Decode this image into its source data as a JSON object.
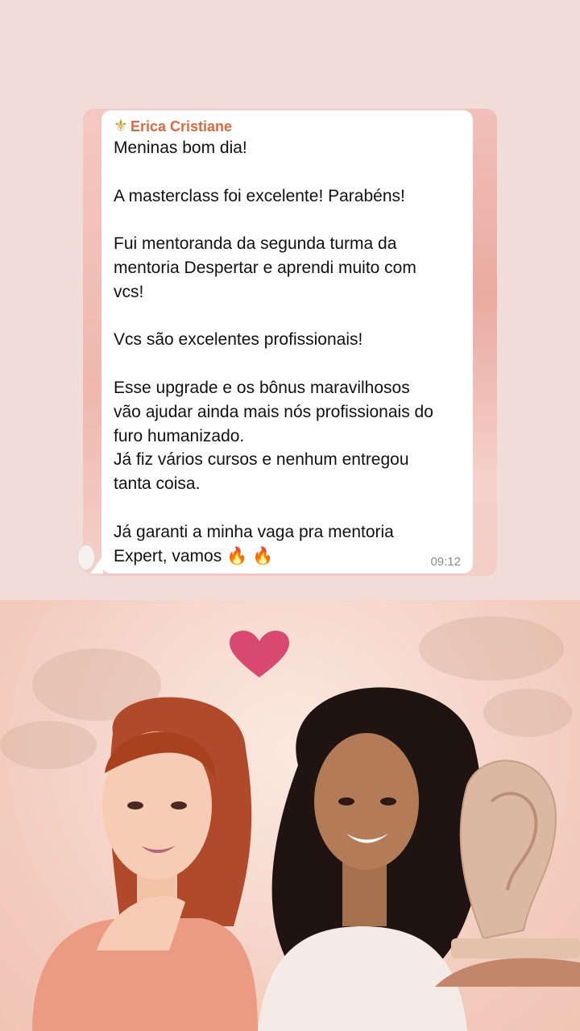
{
  "message": {
    "sender_icon": "fleur-de-lis-icon",
    "sender_name": "Erica Cristiane",
    "lines": [
      "Meninas bom dia!",
      "",
      "A masterclass foi excelente! Parabéns!",
      "",
      "Fui mentoranda da segunda turma da",
      "mentoria Despertar e aprendi muito com",
      "vcs!",
      "",
      "Vcs são excelentes profissionais!",
      "",
      "Esse upgrade e os bônus maravilhosos",
      "vão ajudar ainda mais nós profissionais do",
      "furo humanizado.",
      "Já fiz vários cursos e nenhum entregou",
      "tanta coisa.",
      "",
      "Já garanti a minha vaga pra mentoria",
      "Expert, vamos 🔥 🔥"
    ],
    "time": "09:12"
  },
  "colors": {
    "background": "#f1dcd8",
    "sender_name": "#e0683d",
    "heart": "#d9486f"
  },
  "decor": {
    "heart_icon": "heart-icon",
    "photo": "two-women-smiling-with-golden-ear-sculpture"
  }
}
